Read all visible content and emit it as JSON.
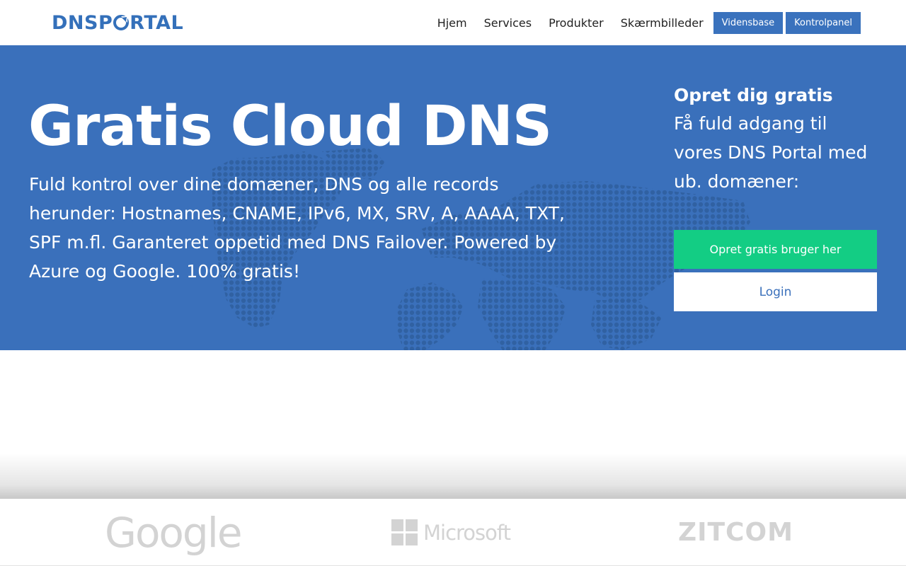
{
  "header": {
    "logo_left": "DNSP",
    "logo_right": "RTAL",
    "nav": [
      {
        "label": "Hjem"
      },
      {
        "label": "Services"
      },
      {
        "label": "Produkter"
      },
      {
        "label": "Skærmbilleder"
      }
    ],
    "buttons": [
      {
        "label": "Vidensbase"
      },
      {
        "label": "Kontrolpanel"
      }
    ]
  },
  "hero": {
    "title": "Gratis Cloud DNS",
    "text": "Fuld kontrol over dine domæner, DNS og alle records herunder: Hostnames, CNAME, IPv6, MX, SRV, A, AAAA, TXT, SPF m.fl. Garanteret oppetid med DNS Failover. Powered by Azure og Google. 100% gratis!",
    "signup_title": "Opret dig gratis",
    "signup_text": "Få fuld adgang til vores DNS Portal med ub. domæner:",
    "cta_primary": "Opret gratis bruger her",
    "cta_secondary": "Login"
  },
  "partners": {
    "google": "Google",
    "microsoft": "Microsoft",
    "zitcom": "ZITCOM"
  },
  "colors": {
    "brand": "#3470ba",
    "hero_bg": "#3a70bb",
    "cta_green": "#13cd84",
    "partner_gray": "#d3d3d3"
  },
  "icons": [
    "logo-o-arrow-icon",
    "world-map-dots",
    "windows-logo-icon"
  ]
}
